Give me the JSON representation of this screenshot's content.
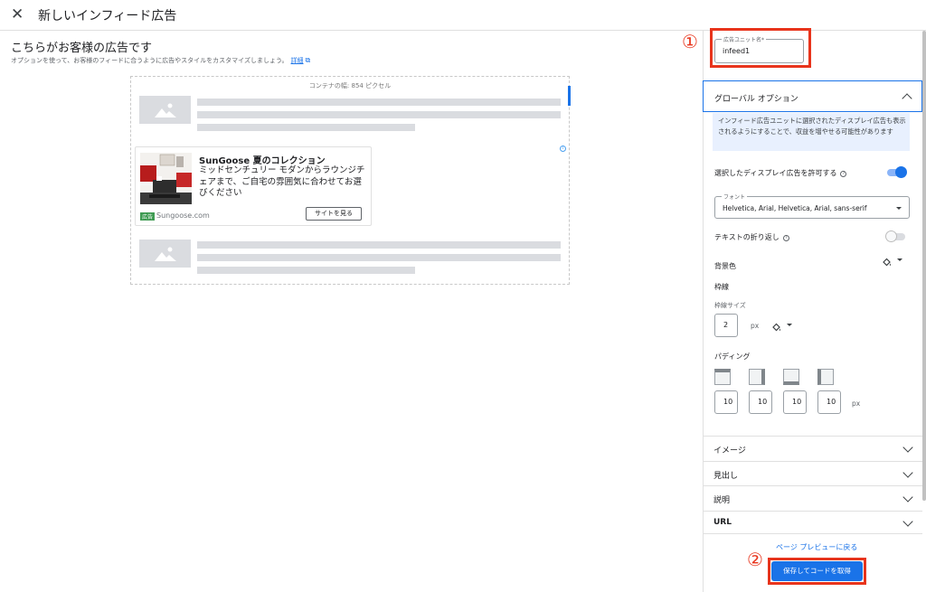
{
  "header": {
    "close_icon": "close-icon",
    "title": "新しいインフィード広告"
  },
  "preview": {
    "heading": "こちらがお客様の広告です",
    "subtext": "オプションを使って、お客様のフィードに合うように広告やスタイルをカスタマイズしましょう。",
    "details_link": "詳細",
    "container_width": "コンテナの幅: 854 ピクセル",
    "ad": {
      "title": "SunGoose 夏のコレクション",
      "description": "ミッドセンチュリー モダンからラウンジチェアまで、ご自宅の雰囲気に合わせてお選びください",
      "badge": "広告",
      "domain": "Sungoose.com",
      "cta": "サイトを見る"
    }
  },
  "annotations": {
    "step1": "①",
    "step2": "②",
    "color": "#e8341c"
  },
  "panel": {
    "ad_unit_name_label": "広告ユニット名*",
    "ad_unit_name_value": "infeed1",
    "global_options_label": "グローバル オプション",
    "info_text": "インフィード広告ユニットに選択されたディスプレイ広告も表示されるようにすることで、収益を増やせる可能性があります",
    "allow_display_label": "選択したディスプレイ広告を許可する",
    "allow_display_on": true,
    "font_label": "フォント",
    "font_value": "Helvetica, Arial, Helvetica, Arial, sans-serif",
    "text_wrap_label": "テキストの折り返し",
    "text_wrap_on": false,
    "bg_color_label": "背景色",
    "border_label": "枠線",
    "border_size_label": "枠線サイズ",
    "border_size_value": "2",
    "px": "px",
    "padding_label": "パディング",
    "padding_values": [
      "10",
      "10",
      "10",
      "10"
    ],
    "sections": [
      "イメージ",
      "見出し",
      "説明",
      "URL"
    ],
    "preview_link": "ページ プレビューに戻る",
    "save_button": "保存してコードを取得"
  },
  "colors": {
    "accent": "#1a73e8",
    "annotation": "#e8341c",
    "placeholder": "#dadce0"
  }
}
